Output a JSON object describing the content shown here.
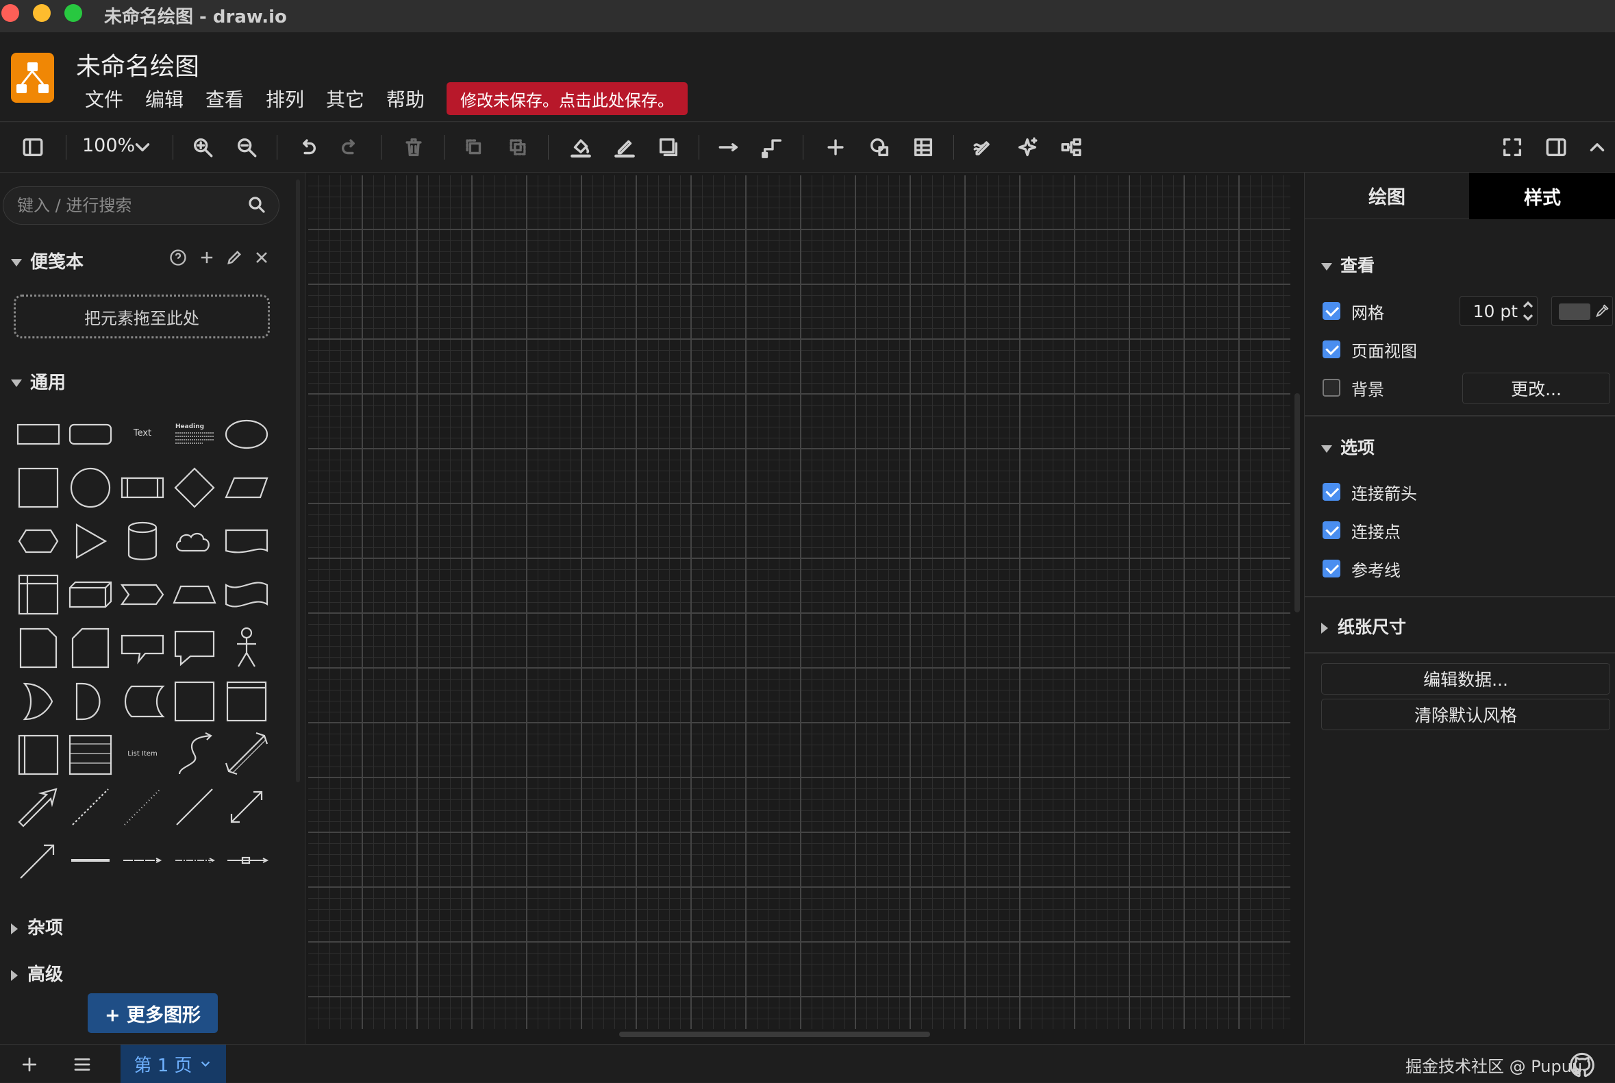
{
  "window": {
    "title": "未命名绘图 - draw.io"
  },
  "header": {
    "doc_title": "未命名绘图",
    "menu": [
      "文件",
      "编辑",
      "查看",
      "排列",
      "其它",
      "帮助"
    ],
    "unsaved_notice": "修改未保存。点击此处保存。"
  },
  "toolbar": {
    "zoom": "100%"
  },
  "sidebar": {
    "search_placeholder": "键入 / 进行搜索",
    "scratchpad": {
      "title": "便笺本",
      "drop_hint": "把元素拖至此处"
    },
    "general": {
      "title": "通用"
    },
    "shape_text": {
      "text": "Text",
      "heading": "Heading",
      "list_item": "List Item"
    },
    "misc": {
      "title": "杂项"
    },
    "advanced": {
      "title": "高级"
    },
    "more_shapes": "+ 更多图形"
  },
  "format_panel": {
    "tabs": [
      "绘图",
      "样式"
    ],
    "view": {
      "title": "查看",
      "grid": {
        "label": "网格",
        "checked": true,
        "size": "10 pt"
      },
      "page_view": {
        "label": "页面视图",
        "checked": true
      },
      "background": {
        "label": "背景",
        "checked": false,
        "button": "更改..."
      }
    },
    "options": {
      "title": "选项",
      "connection_arrows": {
        "label": "连接箭头",
        "checked": true
      },
      "connection_points": {
        "label": "连接点",
        "checked": true
      },
      "guides": {
        "label": "参考线",
        "checked": true
      }
    },
    "paper_size": {
      "title": "纸张尺寸"
    },
    "edit_data": "编辑数据...",
    "clear_style": "清除默认风格"
  },
  "statusbar": {
    "page_tab": "第 1 页",
    "credit": "掘金技术社区 @ Pupuu"
  },
  "colors": {
    "accent": "#4a8ef0",
    "unsaved": "#b8182a",
    "logo": "#f08705",
    "page_tab": "#163a66"
  }
}
